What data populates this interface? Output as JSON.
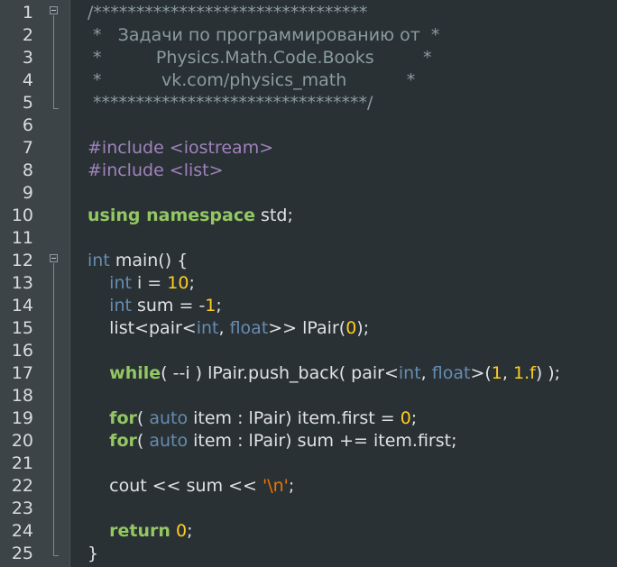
{
  "editor": {
    "lines": [
      {
        "number": "1",
        "tokens": [
          {
            "t": "/********************************",
            "c": "comment"
          }
        ]
      },
      {
        "number": "2",
        "tokens": [
          {
            "t": " *   Задачи по программированию от  *",
            "c": "comment"
          }
        ]
      },
      {
        "number": "3",
        "tokens": [
          {
            "t": " *          Physics.Math.Code.Books         *",
            "c": "comment"
          }
        ]
      },
      {
        "number": "4",
        "tokens": [
          {
            "t": " *           vk.com/physics_math           *",
            "c": "comment"
          }
        ]
      },
      {
        "number": "5",
        "tokens": [
          {
            "t": " ********************************/",
            "c": "comment"
          }
        ]
      },
      {
        "number": "6",
        "tokens": []
      },
      {
        "number": "7",
        "tokens": [
          {
            "t": "#include <iostream>",
            "c": "pre"
          }
        ]
      },
      {
        "number": "8",
        "tokens": [
          {
            "t": "#include <list>",
            "c": "pre"
          }
        ]
      },
      {
        "number": "9",
        "tokens": []
      },
      {
        "number": "10",
        "tokens": [
          {
            "t": "using namespace",
            "c": "kw"
          },
          {
            "t": " std;",
            "c": "plain"
          }
        ]
      },
      {
        "number": "11",
        "tokens": []
      },
      {
        "number": "12",
        "tokens": [
          {
            "t": "int",
            "c": "type"
          },
          {
            "t": " main() {",
            "c": "plain"
          }
        ]
      },
      {
        "number": "13",
        "tokens": [
          {
            "t": "    ",
            "c": "plain"
          },
          {
            "t": "int",
            "c": "type"
          },
          {
            "t": " i = ",
            "c": "plain"
          },
          {
            "t": "10",
            "c": "num"
          },
          {
            "t": ";",
            "c": "plain"
          }
        ]
      },
      {
        "number": "14",
        "tokens": [
          {
            "t": "    ",
            "c": "plain"
          },
          {
            "t": "int",
            "c": "type"
          },
          {
            "t": " sum = -",
            "c": "plain"
          },
          {
            "t": "1",
            "c": "num"
          },
          {
            "t": ";",
            "c": "plain"
          }
        ]
      },
      {
        "number": "15",
        "tokens": [
          {
            "t": "    list<pair<",
            "c": "plain"
          },
          {
            "t": "int",
            "c": "type"
          },
          {
            "t": ", ",
            "c": "plain"
          },
          {
            "t": "float",
            "c": "type"
          },
          {
            "t": ">> lPair(",
            "c": "plain"
          },
          {
            "t": "0",
            "c": "num"
          },
          {
            "t": ");",
            "c": "plain"
          }
        ]
      },
      {
        "number": "16",
        "tokens": []
      },
      {
        "number": "17",
        "tokens": [
          {
            "t": "    ",
            "c": "plain"
          },
          {
            "t": "while",
            "c": "kw"
          },
          {
            "t": "( --i ) lPair.push_back( pair<",
            "c": "plain"
          },
          {
            "t": "int",
            "c": "type"
          },
          {
            "t": ", ",
            "c": "plain"
          },
          {
            "t": "float",
            "c": "type"
          },
          {
            "t": ">(",
            "c": "plain"
          },
          {
            "t": "1",
            "c": "num"
          },
          {
            "t": ", ",
            "c": "plain"
          },
          {
            "t": "1.f",
            "c": "num"
          },
          {
            "t": ") );",
            "c": "plain"
          }
        ]
      },
      {
        "number": "18",
        "tokens": []
      },
      {
        "number": "19",
        "tokens": [
          {
            "t": "    ",
            "c": "plain"
          },
          {
            "t": "for",
            "c": "kw"
          },
          {
            "t": "( ",
            "c": "plain"
          },
          {
            "t": "auto",
            "c": "type"
          },
          {
            "t": " item : lPair) item.first = ",
            "c": "plain"
          },
          {
            "t": "0",
            "c": "num"
          },
          {
            "t": ";",
            "c": "plain"
          }
        ]
      },
      {
        "number": "20",
        "tokens": [
          {
            "t": "    ",
            "c": "plain"
          },
          {
            "t": "for",
            "c": "kw"
          },
          {
            "t": "( ",
            "c": "plain"
          },
          {
            "t": "auto",
            "c": "type"
          },
          {
            "t": " item : lPair) sum += item.first;",
            "c": "plain"
          }
        ]
      },
      {
        "number": "21",
        "tokens": []
      },
      {
        "number": "22",
        "tokens": [
          {
            "t": "    cout << sum << ",
            "c": "plain"
          },
          {
            "t": "'\\n'",
            "c": "str"
          },
          {
            "t": ";",
            "c": "plain"
          }
        ]
      },
      {
        "number": "23",
        "tokens": []
      },
      {
        "number": "24",
        "tokens": [
          {
            "t": "    ",
            "c": "plain"
          },
          {
            "t": "return",
            "c": "kw"
          },
          {
            "t": " ",
            "c": "plain"
          },
          {
            "t": "0",
            "c": "num"
          },
          {
            "t": ";",
            "c": "plain"
          }
        ]
      },
      {
        "number": "25",
        "tokens": [
          {
            "t": "}",
            "c": "plain"
          }
        ]
      }
    ]
  },
  "colors": {
    "background": "#293134",
    "gutter": "#3c4447",
    "comment": "#8b9ba0",
    "preprocessor": "#a082bd",
    "keyword": "#93c763",
    "type": "#678cb1",
    "number": "#ffcd22",
    "string": "#ec7600",
    "text": "#e0e2e4"
  }
}
